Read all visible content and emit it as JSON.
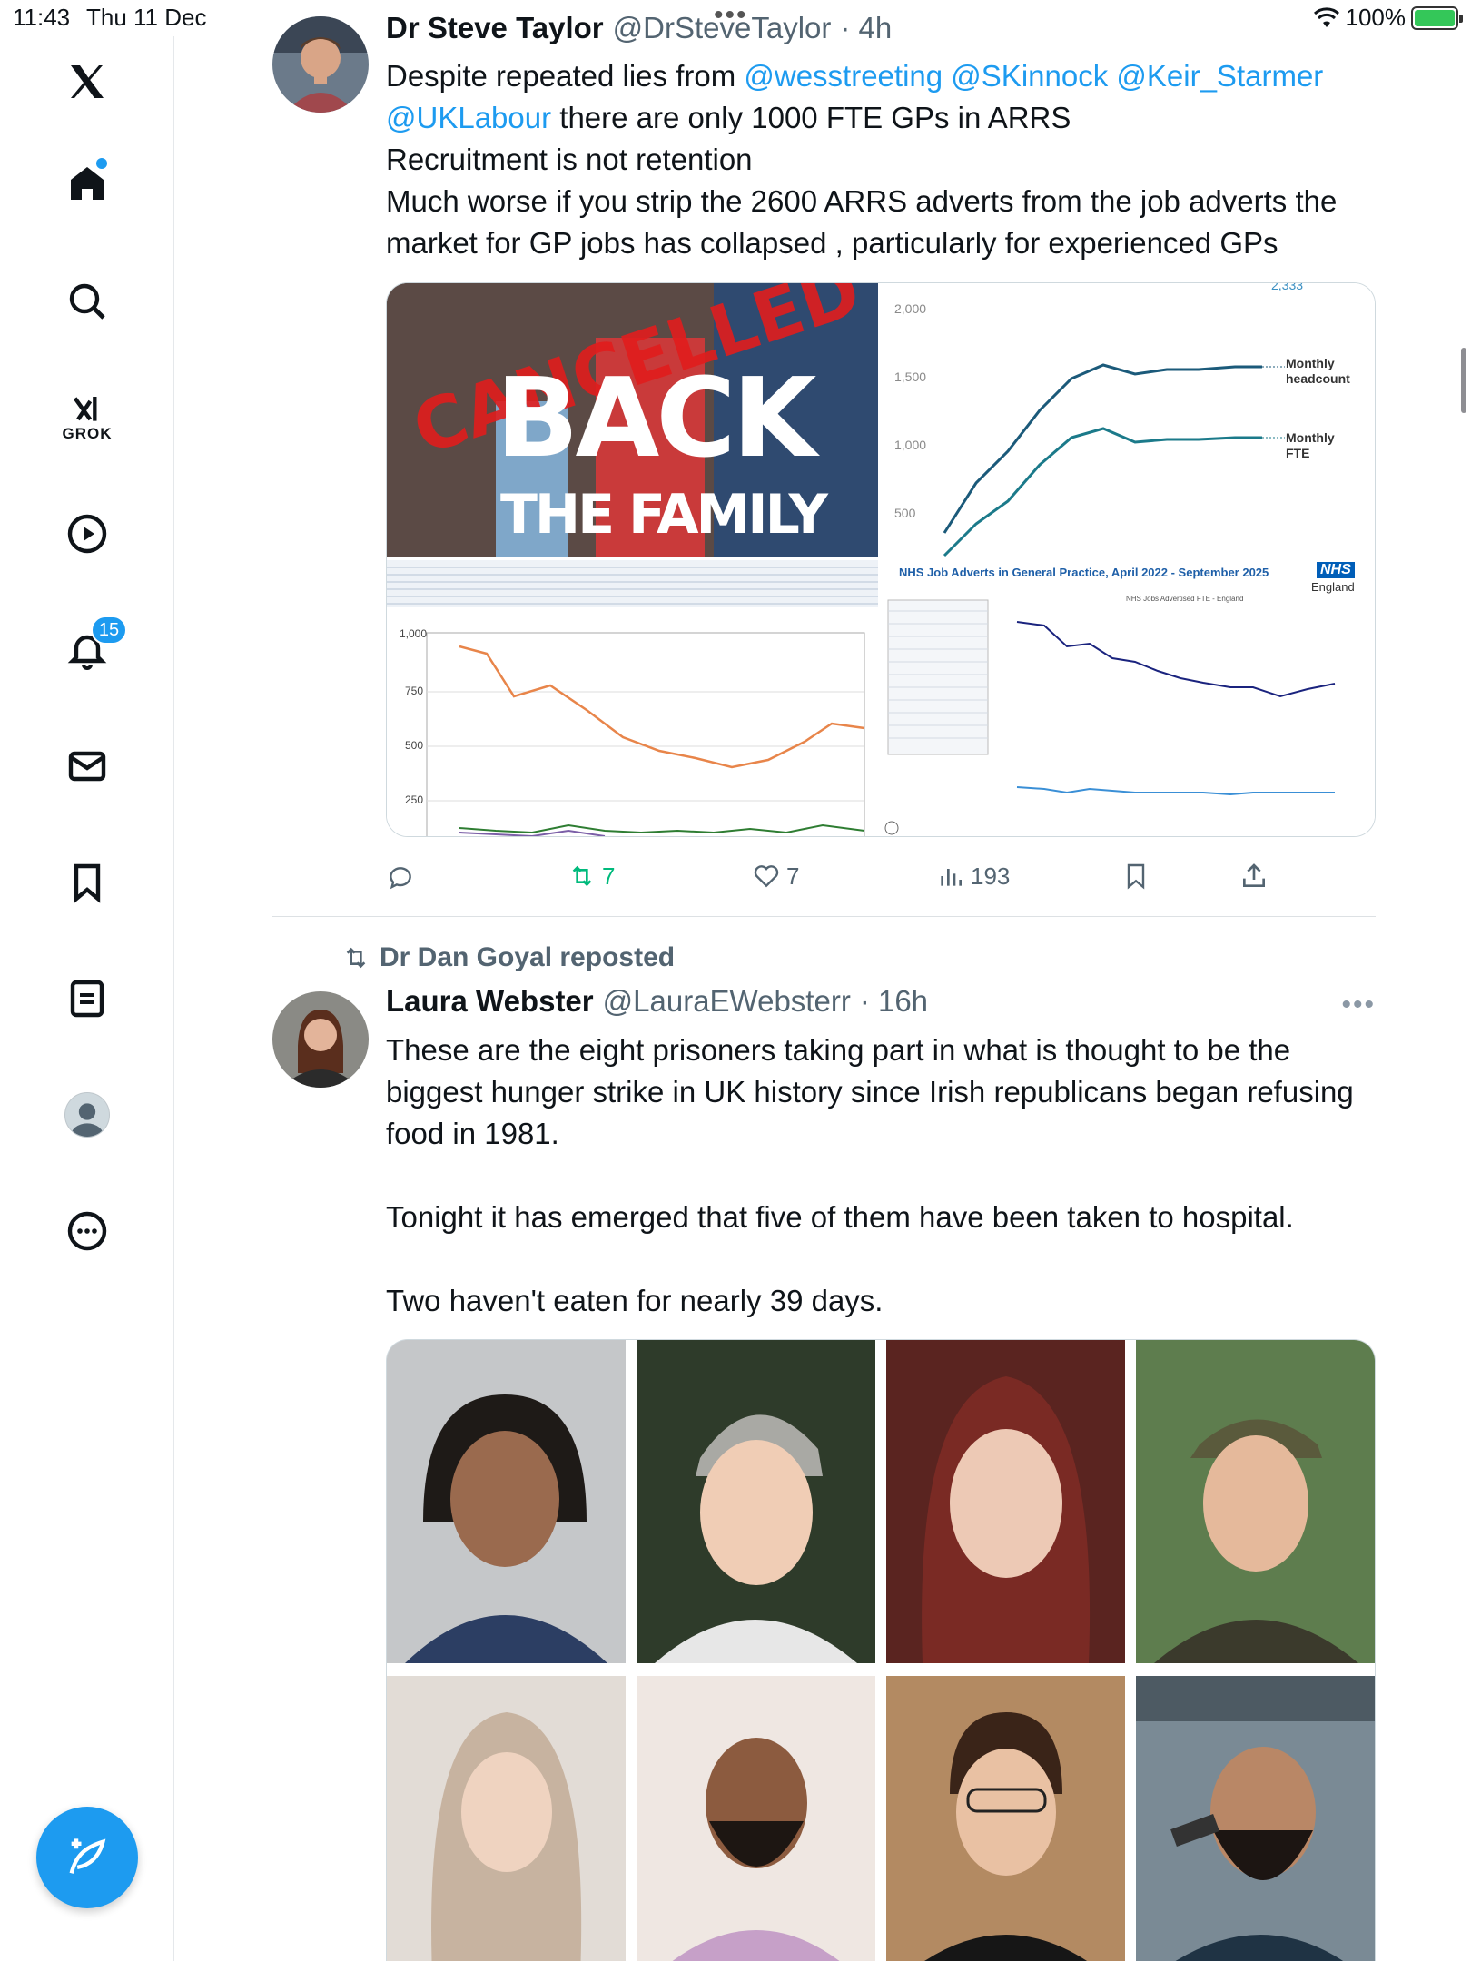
{
  "status_bar": {
    "time": "11:43",
    "date": "Thu 11 Dec",
    "battery": "100%"
  },
  "sidebar": {
    "grok_label": "GROK",
    "notifications_badge": "15",
    "icons": [
      "x-logo-icon",
      "home-icon",
      "search-icon",
      "grok-icon",
      "video-icon",
      "notifications-icon",
      "messages-icon",
      "bookmarks-icon",
      "lists-icon",
      "profile-icon",
      "more-icon"
    ]
  },
  "tweets": [
    {
      "author": "Dr Steve Taylor",
      "handle": "@DrSteveTaylor",
      "time": "· 4h",
      "text_mentions": [
        "@wesstreeting",
        "@SKinnock",
        "@Keir_Starmer",
        "@UKLabour"
      ],
      "text_line1_prefix": "Despite repeated lies from ",
      "text_line2_suffix": " there are only 1000 FTE GPs  in ARRS",
      "text_line3": "Recruitment is not retention",
      "text_line4": "Much worse if you strip the 2600 ARRS adverts from the job adverts the market for GP jobs has collapsed  , particularly for experienced GPs",
      "media": {
        "image1_words": [
          "CANCELLED",
          "BACK",
          "THE FAMILY"
        ],
        "image2_labels": {
          "top_value": "2,333",
          "series1": "Monthly headcount",
          "series2": "Monthly FTE",
          "ticks": [
            "2,000",
            "1,500",
            "1,000",
            "500"
          ]
        },
        "image3_ticks": [
          "1,000",
          "750",
          "500",
          "250"
        ],
        "image4_title": "NHS Job Adverts in General Practice, April 2022 - September 2025",
        "image4_subtitle": "NHS Jobs Advertised FTE - England",
        "image4_brand": "NHS",
        "image4_brand_sub": "England"
      },
      "actions": {
        "reposts": "7",
        "likes": "7",
        "views": "193"
      },
      "accent": "#1d9bf0",
      "repost_color": "#00ba7c"
    },
    {
      "reposted_by": "Dr Dan Goyal reposted",
      "author": "Laura Webster",
      "handle": "@LauraEWebsterr",
      "time": "· 16h",
      "text_p1": "These are the eight prisoners taking part in what is thought to be the biggest hunger strike in UK history since Irish republicans began refusing food in 1981.",
      "text_p2": "Tonight it has emerged that five of them have been taken to hospital.",
      "text_p3": "Two haven't eaten for nearly 39 days.",
      "media_count": 8
    }
  ]
}
